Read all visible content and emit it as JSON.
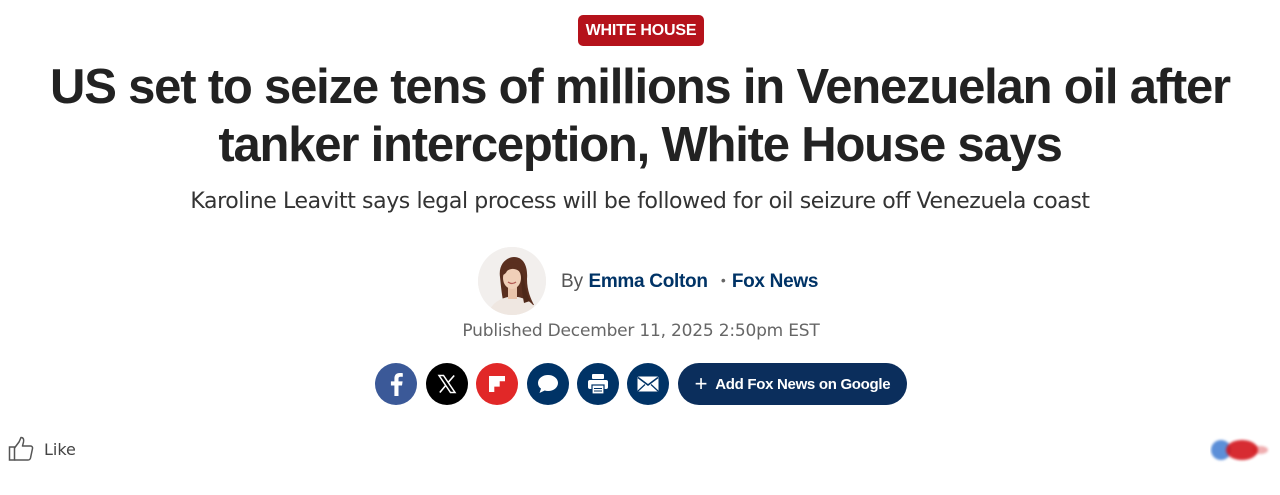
{
  "article": {
    "category": "WHITE HOUSE",
    "headline": "US set to seize tens of millions in Venezuelan oil after tanker interception, White House says",
    "subheadline": "Karoline Leavitt says legal process will be followed for oil seizure off Venezuela coast",
    "byline_prefix": "By",
    "author": "Emma Colton",
    "outlet": "Fox News",
    "published": "Published December 11, 2025 2:50pm EST"
  },
  "share": {
    "buttons": [
      {
        "name": "facebook",
        "icon": "facebook-icon",
        "color": "#3b5998"
      },
      {
        "name": "x",
        "icon": "x-icon",
        "color": "#000000"
      },
      {
        "name": "flipboard",
        "icon": "flipboard-icon",
        "color": "#e12828"
      },
      {
        "name": "comments",
        "icon": "comment-icon",
        "color": "#003366"
      },
      {
        "name": "print",
        "icon": "print-icon",
        "color": "#003366"
      },
      {
        "name": "email",
        "icon": "email-icon",
        "color": "#003366"
      }
    ],
    "google_label": "Add Fox News on Google"
  },
  "footer": {
    "like_label": "Like"
  },
  "colors": {
    "category_bg": "#b5121b",
    "navy": "#003366",
    "google_button_bg": "#0b2e5c"
  }
}
